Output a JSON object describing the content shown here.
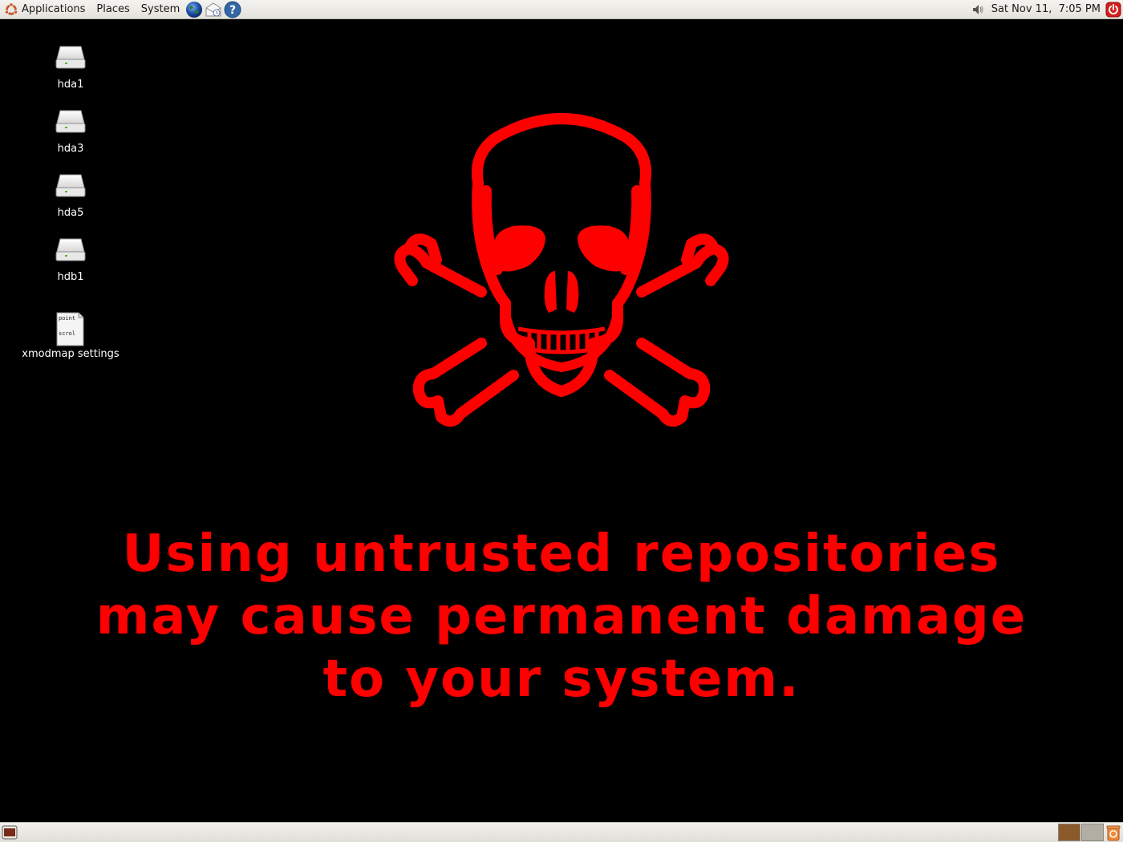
{
  "top_panel": {
    "menus": {
      "applications": "Applications",
      "places": "Places",
      "system": "System"
    },
    "launchers": [
      "web-browser-icon",
      "email-client-icon",
      "help-icon"
    ],
    "clock": "Sat Nov 11,  7:05 PM"
  },
  "desktop": {
    "icons": [
      {
        "label": "hda1",
        "icon": "drive-icon"
      },
      {
        "label": "hda3",
        "icon": "drive-icon"
      },
      {
        "label": "hda5",
        "icon": "drive-icon"
      },
      {
        "label": "hdb1",
        "icon": "drive-icon"
      },
      {
        "label": "xmodmap settings",
        "icon": "text-file-icon"
      }
    ],
    "file_icon_preview": [
      "point",
      "scrol"
    ]
  },
  "wallpaper": {
    "warning_lines": [
      "Using untrusted repositories",
      "may cause permanent damage",
      "to your system."
    ],
    "color": "#ff0000",
    "graphic": "skull-and-crossbones"
  },
  "bottom_panel": {
    "workspaces": [
      {
        "color": "#8b5a2b",
        "active": true
      },
      {
        "color": "#b3aea4",
        "active": false
      }
    ]
  }
}
